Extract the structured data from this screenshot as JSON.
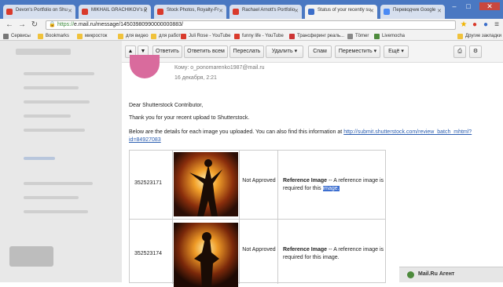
{
  "tabs": [
    {
      "label": "Devon's Portfolio on Shu",
      "color": "#d93a2b"
    },
    {
      "label": "MIKHAIL GRACHIKOV's P",
      "color": "#d93a2b"
    },
    {
      "label": "Stock Photos, Royalty-Fr",
      "color": "#d93a2b"
    },
    {
      "label": "Rachael Arnott's Portfolio",
      "color": "#d93a2b"
    },
    {
      "label": "Status of your recently su",
      "color": "#3b6ec9",
      "active": true
    },
    {
      "label": "Переводчик Google",
      "color": "#4a8af4"
    }
  ],
  "address": {
    "scheme": "https://",
    "rest": "e.mail.ru/message/14503980990000000883/"
  },
  "bookmarks": [
    {
      "label": "Сервисы",
      "color": "#777777"
    },
    {
      "label": "Bookmarks",
      "color": "#f0c23b"
    },
    {
      "label": "микросток",
      "color": "#f0c23b"
    },
    {
      "label": "для видео",
      "color": "#f0c23b"
    },
    {
      "label": "для работы",
      "color": "#f0c23b"
    },
    {
      "label": "Juli Rose - YouTube",
      "color": "#d93a2b"
    },
    {
      "label": "funny life - YouTube",
      "color": "#d93a2b"
    },
    {
      "label": "Трансферинг реаль...",
      "color": "#cc3333"
    },
    {
      "label": "Tömer",
      "color": "#888888"
    },
    {
      "label": "Livemocha",
      "color": "#4d8a3c"
    },
    {
      "label": "Другие закладки",
      "color": "#f0c23b"
    }
  ],
  "toolbar": {
    "reply": "Ответить",
    "reply_all": "Ответить всем",
    "forward": "Переслать",
    "delete": "Удалить",
    "spam": "Спам",
    "move": "Переместить",
    "more": "Ещё"
  },
  "header": {
    "to_label": "Кому:",
    "to_value": "o_ponomarenko1987@mail.ru",
    "date": "16 декабря, 2:21"
  },
  "body": {
    "greeting": "Dear Shutterstock Contributor,",
    "thanks": "Thank you for your recent upload to Shutterstock.",
    "details": "Below are the details for each image you uploaded. You can also find this information at",
    "link_part1": "http://submit.shutterstock.com/review_batch_mhtml?",
    "link_part2": "id=84927083"
  },
  "rows": [
    {
      "id": "352523171",
      "status": "Not Approved",
      "reason_title": "Reference Image",
      "reason_text": " -- A reference image is",
      "reason_text2": "required for this ",
      "selected": "image."
    },
    {
      "id": "352523174",
      "status": "Not Approved",
      "reason_title": "Reference Image",
      "reason_text": " -- A reference image is",
      "reason_text2": "required for this image.",
      "selected": ""
    }
  ],
  "agent": {
    "label": "Mail.Ru Агент"
  }
}
